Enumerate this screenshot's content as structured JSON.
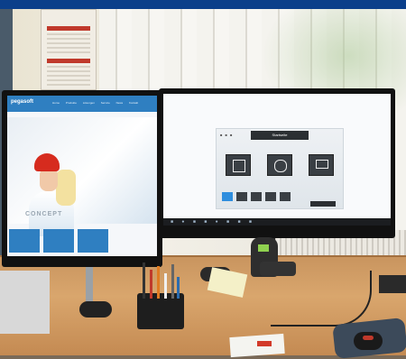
{
  "scene": {
    "description_kind": "office-desk-photo"
  },
  "left_monitor": {
    "logo": "pegasoft",
    "nav": [
      "Home",
      "Produkte",
      "Lösungen",
      "Service",
      "News",
      "Kontakt"
    ],
    "hero_text": "CONCEPT",
    "tiles": [
      "",
      "",
      ""
    ]
  },
  "right_monitor": {
    "dialog_title": "Startseite",
    "dialog_dots": "■ ■ ■",
    "icons": [
      {
        "name": "list-icon",
        "label": ""
      },
      {
        "name": "share-icon",
        "label": ""
      },
      {
        "name": "monitor-icon",
        "label": ""
      }
    ],
    "ok_label": "",
    "brand": ""
  },
  "colors": {
    "top_bar": "#0b3f8a",
    "web_blue": "#2f7fc1",
    "helmet_red": "#d62b1e",
    "desk_wood": "#d9a66d"
  }
}
